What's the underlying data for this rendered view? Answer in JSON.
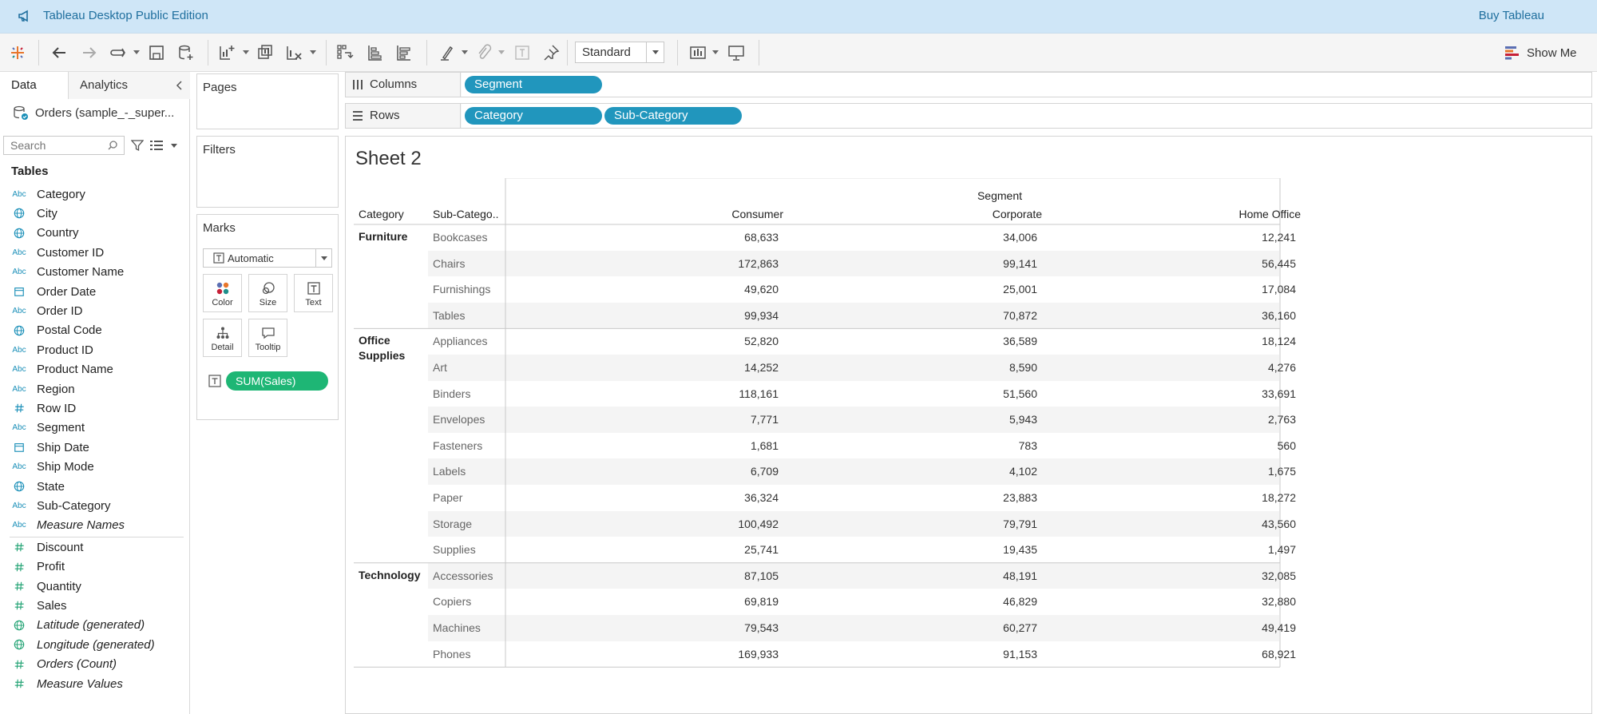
{
  "app": {
    "title": "Tableau Desktop Public Edition",
    "buy_label": "Buy Tableau"
  },
  "toolbar": {
    "standard_select": "Standard",
    "show_me_label": "Show Me"
  },
  "data_pane": {
    "tab_data": "Data",
    "tab_analytics": "Analytics",
    "datasource": "Orders (sample_-_super...",
    "search_placeholder": "Search",
    "tables_heading": "Tables",
    "dimensions": [
      {
        "label": "Category",
        "icon": "abc-icon",
        "italic": false
      },
      {
        "label": "City",
        "icon": "globe-icon",
        "italic": false
      },
      {
        "label": "Country",
        "icon": "globe-icon",
        "italic": false
      },
      {
        "label": "Customer ID",
        "icon": "abc-icon",
        "italic": false
      },
      {
        "label": "Customer Name",
        "icon": "abc-icon",
        "italic": false
      },
      {
        "label": "Order Date",
        "icon": "calendar-icon",
        "italic": false
      },
      {
        "label": "Order ID",
        "icon": "abc-icon",
        "italic": false
      },
      {
        "label": "Postal Code",
        "icon": "globe-icon",
        "italic": false
      },
      {
        "label": "Product ID",
        "icon": "abc-icon",
        "italic": false
      },
      {
        "label": "Product Name",
        "icon": "abc-icon",
        "italic": false
      },
      {
        "label": "Region",
        "icon": "abc-icon",
        "italic": false
      },
      {
        "label": "Row ID",
        "icon": "hash-icon",
        "italic": false
      },
      {
        "label": "Segment",
        "icon": "abc-icon",
        "italic": false
      },
      {
        "label": "Ship Date",
        "icon": "calendar-icon",
        "italic": false
      },
      {
        "label": "Ship Mode",
        "icon": "abc-icon",
        "italic": false
      },
      {
        "label": "State",
        "icon": "globe-icon",
        "italic": false
      },
      {
        "label": "Sub-Category",
        "icon": "abc-icon",
        "italic": false
      },
      {
        "label": "Measure Names",
        "icon": "abc-icon",
        "italic": true
      }
    ],
    "measures": [
      {
        "label": "Discount",
        "icon": "hash-icon",
        "italic": false
      },
      {
        "label": "Profit",
        "icon": "hash-icon",
        "italic": false
      },
      {
        "label": "Quantity",
        "icon": "hash-icon",
        "italic": false
      },
      {
        "label": "Sales",
        "icon": "hash-icon",
        "italic": false
      },
      {
        "label": "Latitude (generated)",
        "icon": "globe-icon",
        "italic": true
      },
      {
        "label": "Longitude (generated)",
        "icon": "globe-icon",
        "italic": true
      },
      {
        "label": "Orders (Count)",
        "icon": "hash-icon",
        "italic": true
      },
      {
        "label": "Measure Values",
        "icon": "hash-icon",
        "italic": true
      }
    ]
  },
  "cards": {
    "pages_title": "Pages",
    "filters_title": "Filters",
    "marks_title": "Marks",
    "mark_type": "Automatic",
    "mark_buttons": {
      "color": "Color",
      "size": "Size",
      "text": "Text",
      "detail": "Detail",
      "tooltip": "Tooltip"
    },
    "sales_pill": "SUM(Sales)"
  },
  "shelves": {
    "columns_label": "Columns",
    "rows_label": "Rows",
    "columns_pills": [
      "Segment"
    ],
    "rows_pills": [
      "Category",
      "Sub-Category"
    ]
  },
  "sheet": {
    "title": "Sheet 2",
    "column_group_header": "Segment",
    "header_category": "Category",
    "header_subcategory": "Sub-Catego..",
    "segments": [
      "Consumer",
      "Corporate",
      "Home Office"
    ],
    "groups": [
      {
        "category": "Furniture",
        "rows": [
          {
            "sub": "Bookcases",
            "values": [
              "68,633",
              "34,006",
              "12,241"
            ]
          },
          {
            "sub": "Chairs",
            "values": [
              "172,863",
              "99,141",
              "56,445"
            ]
          },
          {
            "sub": "Furnishings",
            "values": [
              "49,620",
              "25,001",
              "17,084"
            ]
          },
          {
            "sub": "Tables",
            "values": [
              "99,934",
              "70,872",
              "36,160"
            ]
          }
        ]
      },
      {
        "category": "Office Supplies",
        "rows": [
          {
            "sub": "Appliances",
            "values": [
              "52,820",
              "36,589",
              "18,124"
            ]
          },
          {
            "sub": "Art",
            "values": [
              "14,252",
              "8,590",
              "4,276"
            ]
          },
          {
            "sub": "Binders",
            "values": [
              "118,161",
              "51,560",
              "33,691"
            ]
          },
          {
            "sub": "Envelopes",
            "values": [
              "7,771",
              "5,943",
              "2,763"
            ]
          },
          {
            "sub": "Fasteners",
            "values": [
              "1,681",
              "783",
              "560"
            ]
          },
          {
            "sub": "Labels",
            "values": [
              "6,709",
              "4,102",
              "1,675"
            ]
          },
          {
            "sub": "Paper",
            "values": [
              "36,324",
              "23,883",
              "18,272"
            ]
          },
          {
            "sub": "Storage",
            "values": [
              "100,492",
              "79,791",
              "43,560"
            ]
          },
          {
            "sub": "Supplies",
            "values": [
              "25,741",
              "19,435",
              "1,497"
            ]
          }
        ]
      },
      {
        "category": "Technology",
        "rows": [
          {
            "sub": "Accessories",
            "values": [
              "87,105",
              "48,191",
              "32,085"
            ]
          },
          {
            "sub": "Copiers",
            "values": [
              "69,819",
              "46,829",
              "32,880"
            ]
          },
          {
            "sub": "Machines",
            "values": [
              "79,543",
              "60,277",
              "49,419"
            ]
          },
          {
            "sub": "Phones",
            "values": [
              "169,933",
              "91,153",
              "68,921"
            ]
          }
        ]
      }
    ]
  },
  "colors": {
    "titlebar_bg": "#cfe6f7",
    "dimension_pill": "#2196bd",
    "measure_pill": "#1eb675",
    "dimension_icon": "#1a8fb8",
    "measure_icon": "#22a374",
    "band_row": "#f4f4f4"
  }
}
